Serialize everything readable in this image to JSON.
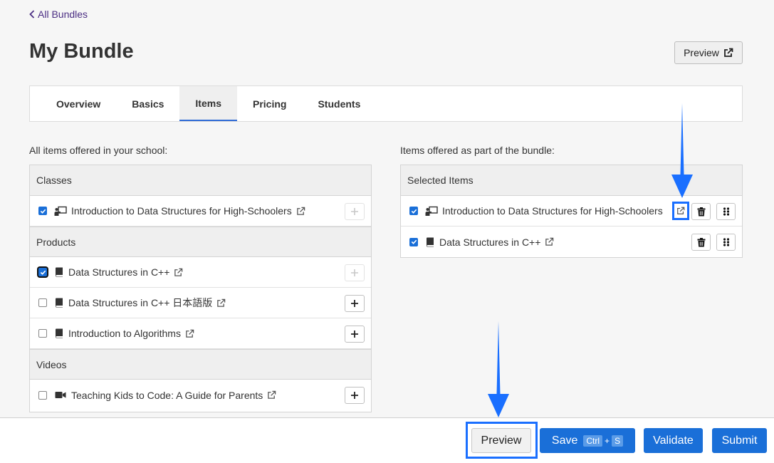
{
  "nav": {
    "back_label": "All Bundles"
  },
  "page": {
    "title": "My Bundle",
    "preview_label": "Preview"
  },
  "tabs": [
    {
      "label": "Overview"
    },
    {
      "label": "Basics"
    },
    {
      "label": "Items",
      "active": true
    },
    {
      "label": "Pricing"
    },
    {
      "label": "Students"
    }
  ],
  "left": {
    "label": "All items offered in your school:",
    "sections": {
      "classes": {
        "header": "Classes",
        "items": [
          {
            "text": "Introduction to Data Structures for High-Schoolers",
            "icon": "classroom-icon",
            "checked": true,
            "add_enabled": false
          }
        ]
      },
      "products": {
        "header": "Products",
        "items": [
          {
            "text": "Data Structures in C++",
            "icon": "book-icon",
            "checked": true,
            "add_enabled": false
          },
          {
            "text": "Data Structures in C++ 日本語版",
            "icon": "book-icon",
            "checked": false,
            "add_enabled": true
          },
          {
            "text": "Introduction to Algorithms",
            "icon": "book-icon",
            "checked": false,
            "add_enabled": true
          }
        ]
      },
      "videos": {
        "header": "Videos",
        "items": [
          {
            "text": "Teaching Kids to Code: A Guide for Parents",
            "icon": "video-icon",
            "checked": false,
            "add_enabled": true
          }
        ]
      }
    }
  },
  "right": {
    "label": "Items offered as part of the bundle:",
    "header": "Selected Items",
    "items": [
      {
        "text": "Introduction to Data Structures for High-Schoolers",
        "icon": "classroom-icon",
        "checked": true
      },
      {
        "text": "Data Structures in C++",
        "icon": "book-icon",
        "checked": true
      }
    ]
  },
  "footer": {
    "preview": "Preview",
    "save": "Save",
    "save_kbd_ctrl": "Ctrl",
    "save_kbd_plus": "+",
    "save_kbd_key": "S",
    "validate": "Validate",
    "submit": "Submit"
  },
  "colors": {
    "primary": "#1a6fd8",
    "highlight": "#1a6fff",
    "brand_link": "#4b2e83"
  }
}
